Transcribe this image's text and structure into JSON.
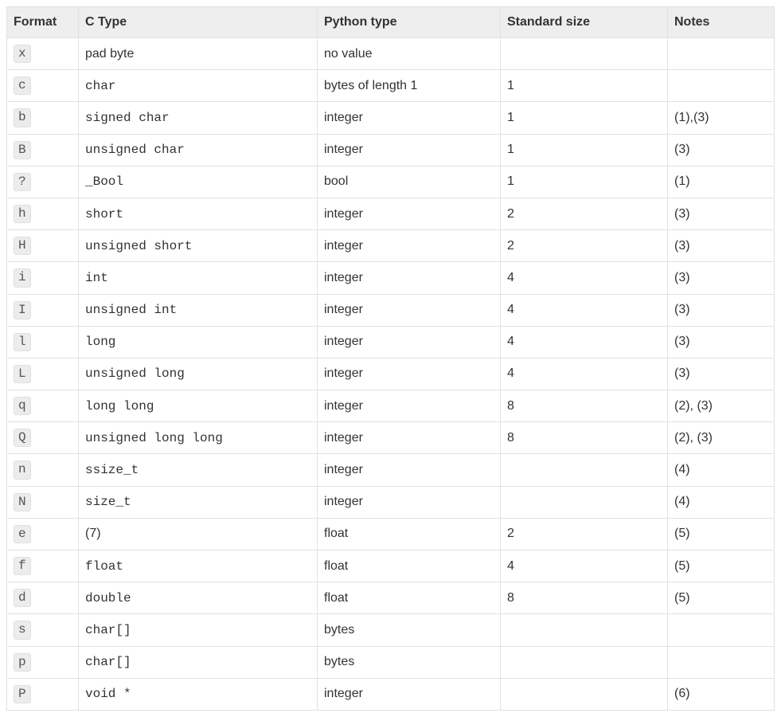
{
  "headers": {
    "format": "Format",
    "ctype": "C Type",
    "python": "Python type",
    "size": "Standard size",
    "notes": "Notes"
  },
  "rows": [
    {
      "format": "x",
      "ctype": "pad byte",
      "ctype_mono": false,
      "python": "no value",
      "size": "",
      "notes": ""
    },
    {
      "format": "c",
      "ctype": "char",
      "ctype_mono": true,
      "python": "bytes of length 1",
      "size": "1",
      "notes": ""
    },
    {
      "format": "b",
      "ctype": "signed char",
      "ctype_mono": true,
      "python": "integer",
      "size": "1",
      "notes": "(1),(3)"
    },
    {
      "format": "B",
      "ctype": "unsigned char",
      "ctype_mono": true,
      "python": "integer",
      "size": "1",
      "notes": "(3)"
    },
    {
      "format": "?",
      "ctype": "_Bool",
      "ctype_mono": true,
      "python": "bool",
      "size": "1",
      "notes": "(1)"
    },
    {
      "format": "h",
      "ctype": "short",
      "ctype_mono": true,
      "python": "integer",
      "size": "2",
      "notes": "(3)"
    },
    {
      "format": "H",
      "ctype": "unsigned short",
      "ctype_mono": true,
      "python": "integer",
      "size": "2",
      "notes": "(3)"
    },
    {
      "format": "i",
      "ctype": "int",
      "ctype_mono": true,
      "python": "integer",
      "size": "4",
      "notes": "(3)"
    },
    {
      "format": "I",
      "ctype": "unsigned int",
      "ctype_mono": true,
      "python": "integer",
      "size": "4",
      "notes": "(3)"
    },
    {
      "format": "l",
      "ctype": "long",
      "ctype_mono": true,
      "python": "integer",
      "size": "4",
      "notes": "(3)"
    },
    {
      "format": "L",
      "ctype": "unsigned long",
      "ctype_mono": true,
      "python": "integer",
      "size": "4",
      "notes": "(3)"
    },
    {
      "format": "q",
      "ctype": "long long",
      "ctype_mono": true,
      "python": "integer",
      "size": "8",
      "notes": "(2), (3)"
    },
    {
      "format": "Q",
      "ctype": "unsigned long long",
      "ctype_mono": true,
      "python": "integer",
      "size": "8",
      "notes": "(2), (3)"
    },
    {
      "format": "n",
      "ctype": "ssize_t",
      "ctype_mono": true,
      "python": "integer",
      "size": "",
      "notes": "(4)"
    },
    {
      "format": "N",
      "ctype": "size_t",
      "ctype_mono": true,
      "python": "integer",
      "size": "",
      "notes": "(4)"
    },
    {
      "format": "e",
      "ctype": "(7)",
      "ctype_mono": false,
      "python": "float",
      "size": "2",
      "notes": "(5)"
    },
    {
      "format": "f",
      "ctype": "float",
      "ctype_mono": true,
      "python": "float",
      "size": "4",
      "notes": "(5)"
    },
    {
      "format": "d",
      "ctype": "double",
      "ctype_mono": true,
      "python": "float",
      "size": "8",
      "notes": "(5)"
    },
    {
      "format": "s",
      "ctype": "char[]",
      "ctype_mono": true,
      "python": "bytes",
      "size": "",
      "notes": ""
    },
    {
      "format": "p",
      "ctype": "char[]",
      "ctype_mono": true,
      "python": "bytes",
      "size": "",
      "notes": ""
    },
    {
      "format": "P",
      "ctype": "void *",
      "ctype_mono": true,
      "python": "integer",
      "size": "",
      "notes": "(6)"
    }
  ]
}
